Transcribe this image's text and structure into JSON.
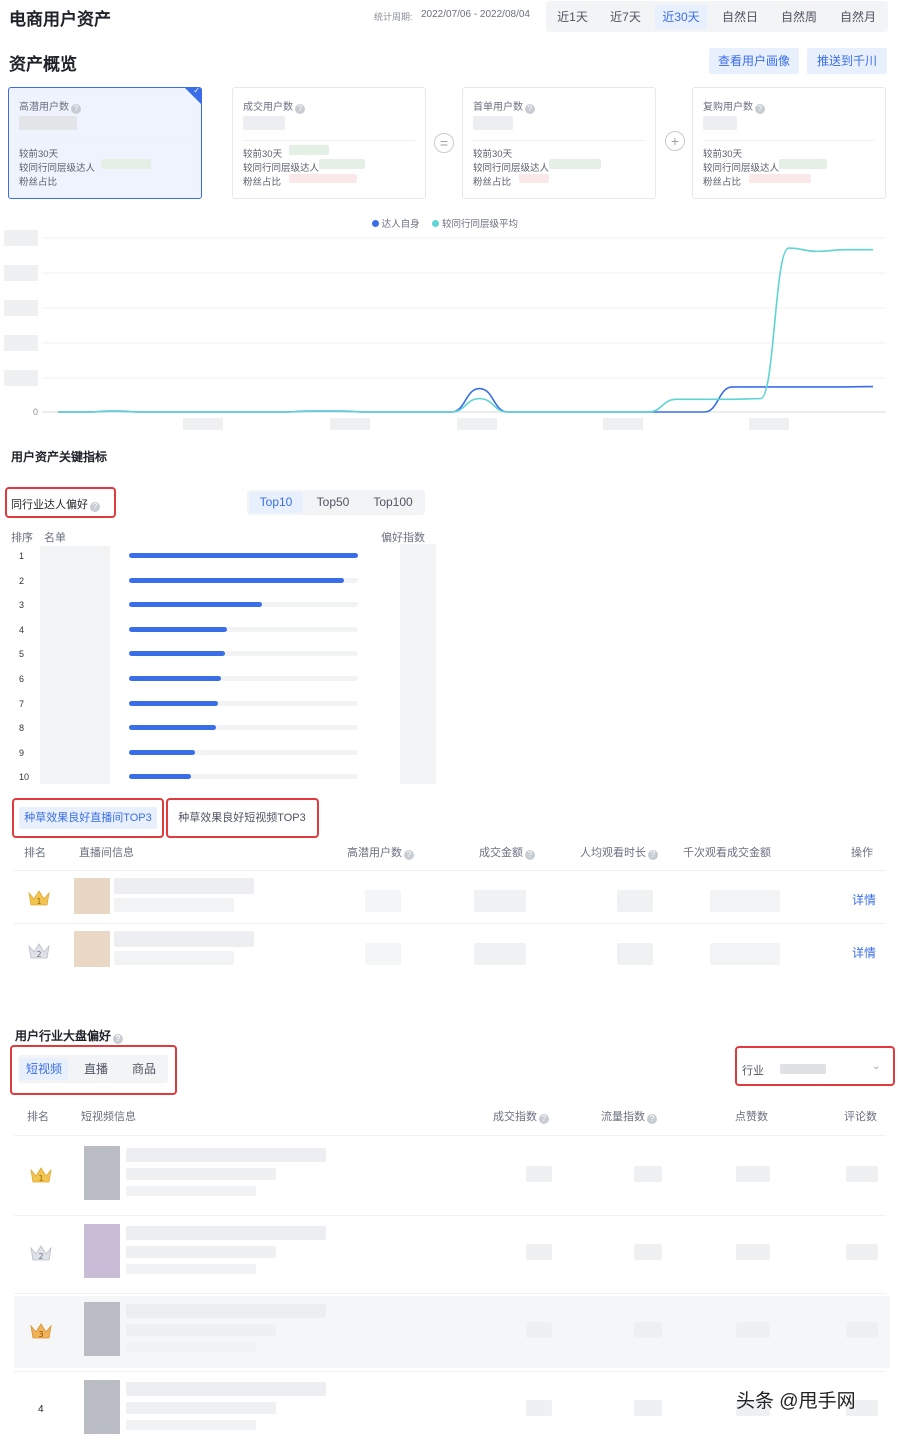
{
  "header": {
    "title": "电商用户资产",
    "period_label": "统计周期:",
    "period_value": "2022/07/06 - 2022/08/04",
    "range_tabs": [
      {
        "label": "近1天",
        "active": false
      },
      {
        "label": "近7天",
        "active": false
      },
      {
        "label": "近30天",
        "active": true
      },
      {
        "label": "自然日",
        "active": false
      },
      {
        "label": "自然周",
        "active": false
      },
      {
        "label": "自然月",
        "active": false
      }
    ]
  },
  "overview": {
    "title": "资产概览",
    "buttons": {
      "view_profile": "查看用户画像",
      "push_qianchuan": "推送到千川"
    },
    "cards": [
      {
        "title": "高潜用户数",
        "active": true
      },
      {
        "title": "成交用户数",
        "active": false
      },
      {
        "title": "首单用户数",
        "active": false
      },
      {
        "title": "复购用户数",
        "active": false
      }
    ],
    "card_rows": [
      "较前30天",
      "较同行同层级达人",
      "粉丝占比"
    ],
    "operators": [
      "=",
      "+"
    ]
  },
  "trend_chart": {
    "legend": [
      {
        "name": "达人自身",
        "color": "#3a6ee8"
      },
      {
        "name": "较同行同层级平均",
        "color": "#5fd4d4"
      }
    ],
    "y_zero_label": "0",
    "series": [
      {
        "name": "达人自身",
        "color": "#3a6ee8",
        "values": [
          0,
          0,
          0.3,
          0,
          0,
          0,
          0,
          0,
          0,
          0.3,
          0.3,
          0,
          0,
          0,
          0,
          7,
          0,
          0,
          0,
          0,
          0,
          0,
          0,
          0,
          7.5,
          7.5,
          7.5,
          7.5,
          7.5,
          7.6
        ]
      },
      {
        "name": "较同行同层级平均",
        "color": "#5fd4d4",
        "values": [
          0,
          0,
          0.2,
          0,
          0,
          0,
          0,
          0,
          0,
          0.2,
          0.2,
          0,
          0,
          0,
          0,
          4,
          0,
          0,
          0,
          0,
          0,
          0,
          3.8,
          3.8,
          3.8,
          4,
          49,
          48,
          48.5,
          48.5
        ]
      }
    ]
  },
  "key_metrics": {
    "title": "用户资产关键指标",
    "peer_pref": {
      "title": "同行业达人偏好",
      "tabs": [
        {
          "label": "Top10",
          "active": true
        },
        {
          "label": "Top50",
          "active": false
        },
        {
          "label": "Top100",
          "active": false
        }
      ],
      "col_rank": "排序",
      "col_name": "名单",
      "col_index": "偏好指数",
      "rows": [
        {
          "rank": "1",
          "value": 1.0
        },
        {
          "rank": "2",
          "value": 0.94
        },
        {
          "rank": "3",
          "value": 0.58
        },
        {
          "rank": "4",
          "value": 0.43
        },
        {
          "rank": "5",
          "value": 0.42
        },
        {
          "rank": "6",
          "value": 0.4
        },
        {
          "rank": "7",
          "value": 0.39
        },
        {
          "rank": "8",
          "value": 0.38
        },
        {
          "rank": "9",
          "value": 0.29
        },
        {
          "rank": "10",
          "value": 0.27
        }
      ]
    },
    "top3": {
      "tabs": [
        {
          "label": "种草效果良好直播间TOP3",
          "active": true
        },
        {
          "label": "种草效果良好短视频TOP3",
          "active": false
        }
      ],
      "columns": [
        "排名",
        "直播间信息",
        "高潜用户数",
        "成交金额",
        "人均观看时长",
        "千次观看成交金额",
        "操作"
      ],
      "action_label": "详情",
      "rows": [
        {
          "rank": "1"
        },
        {
          "rank": "2"
        }
      ]
    }
  },
  "industry": {
    "title": "用户行业大盘偏好",
    "tabs": [
      {
        "label": "短视频",
        "active": true
      },
      {
        "label": "直播",
        "active": false
      },
      {
        "label": "商品",
        "active": false
      }
    ],
    "filter_label": "行业",
    "columns": [
      "排名",
      "短视频信息",
      "成交指数",
      "流量指数",
      "点赞数",
      "评论数"
    ],
    "rows": [
      {
        "rank": "1"
      },
      {
        "rank": "2"
      },
      {
        "rank": "3"
      },
      {
        "rank": "4"
      }
    ]
  },
  "watermark": "头条 @甩手网"
}
